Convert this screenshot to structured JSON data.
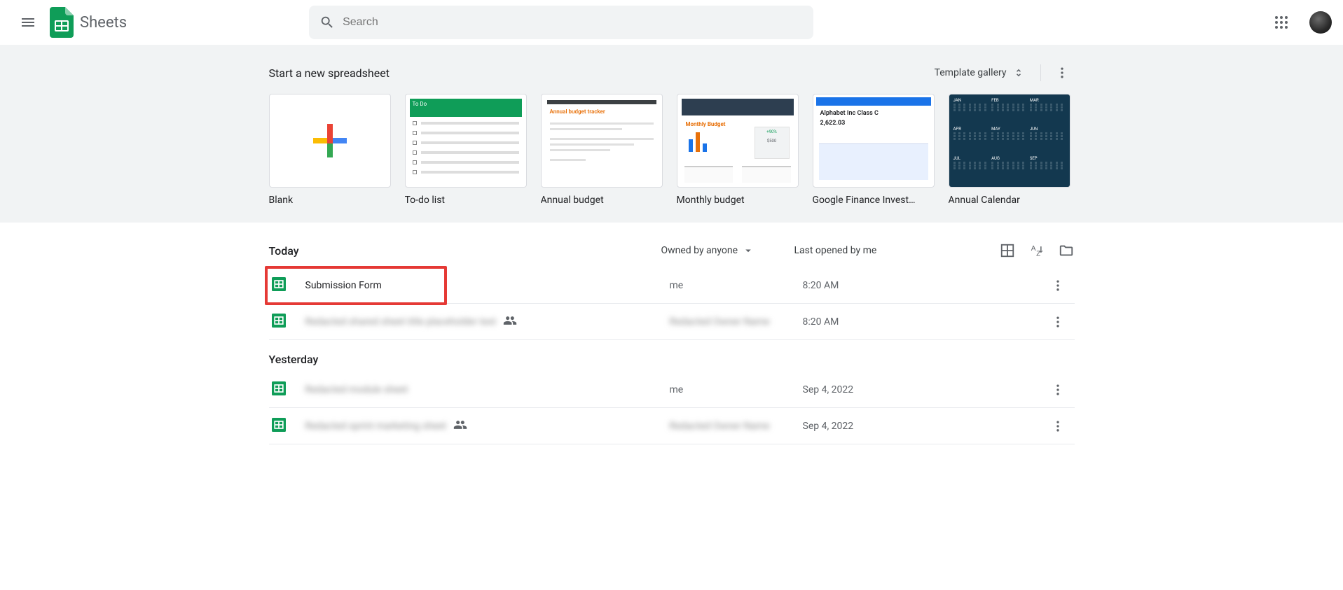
{
  "header": {
    "app_title": "Sheets",
    "search_placeholder": "Search"
  },
  "templates": {
    "section_title": "Start a new spreadsheet",
    "gallery_button": "Template gallery",
    "cards": [
      {
        "label": "Blank"
      },
      {
        "label": "To-do list",
        "thumb_title": "To Do"
      },
      {
        "label": "Annual budget",
        "thumb_title": "Annual budget tracker"
      },
      {
        "label": "Monthly budget",
        "thumb_title": "Monthly Budget",
        "thumb_pct": "+90%",
        "thumb_amt": "$500"
      },
      {
        "label": "Google Finance Invest…",
        "thumb_name": "Alphabet Inc Class C",
        "thumb_price": "2,622.03"
      },
      {
        "label": "Annual Calendar"
      }
    ]
  },
  "files": {
    "owned_filter": "Owned by anyone",
    "sort_label": "Last opened by me",
    "groups": [
      {
        "heading": "Today",
        "rows": [
          {
            "name": "Submission Form",
            "owner": "me",
            "date": "8:20 AM",
            "shared": false,
            "blurred": false,
            "highlighted": true
          },
          {
            "name": "Redacted shared sheet title placeholder text",
            "owner": "Redacted Owner Name",
            "date": "8:20 AM",
            "shared": true,
            "blurred": true,
            "highlighted": false
          }
        ]
      },
      {
        "heading": "Yesterday",
        "rows": [
          {
            "name": "Redacted module sheet",
            "owner": "me",
            "date": "Sep 4, 2022",
            "shared": false,
            "blurred": true,
            "highlighted": false
          },
          {
            "name": "Redacted sprint marketing sheet",
            "owner": "Redacted Owner Name",
            "date": "Sep 4, 2022",
            "shared": true,
            "blurred": true,
            "highlighted": false
          }
        ]
      }
    ]
  }
}
